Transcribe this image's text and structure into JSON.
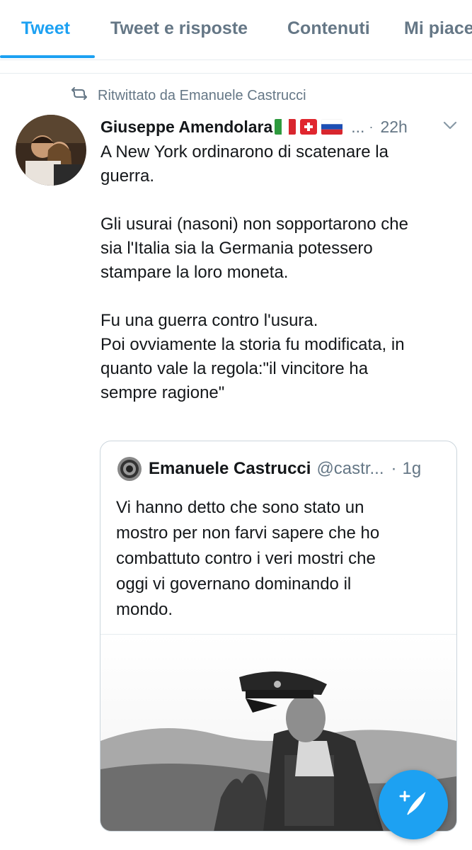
{
  "tabs": [
    {
      "label": "Tweet",
      "active": true
    },
    {
      "label": "Tweet e risposte",
      "active": false
    },
    {
      "label": "Contenuti",
      "active": false
    },
    {
      "label": "Mi piace",
      "active": false
    }
  ],
  "retweet": {
    "label": "Ritwittato da Emanuele Castrucci",
    "icon": "retweet-icon"
  },
  "tweet": {
    "author_name": "Giuseppe Amendolara",
    "flags": [
      "italy-flag",
      "switzerland-flag",
      "russia-flag"
    ],
    "ellipsis": "...",
    "time": "22h",
    "paragraphs": [
      [
        "A New York ordinarono di scatenare la",
        "guerra."
      ],
      [
        "Gli usurai (nasoni) non sopportarono che",
        "sia l'Italia sia la Germania potessero",
        "stampare la loro moneta."
      ],
      [
        "Fu una guerra contro l'usura.",
        "Poi ovviamente la storia fu modificata, in",
        "quanto vale la regola:\"il vincitore ha",
        "sempre ragione\""
      ]
    ]
  },
  "quote": {
    "author_name": "Emanuele Castrucci",
    "handle": "@castr...",
    "separator": "·",
    "time": "1g",
    "lines": [
      "Vi hanno detto che sono stato un",
      "mostro per non farvi sapere che ho",
      "combattuto contro i veri mostri che",
      "oggi vi governano dominando il",
      "mondo."
    ]
  },
  "colors": {
    "accent": "#1da1f2",
    "secondary_text": "#657786",
    "border": "#e6ecf0"
  },
  "fab": {
    "icon": "compose-tweet-icon"
  }
}
